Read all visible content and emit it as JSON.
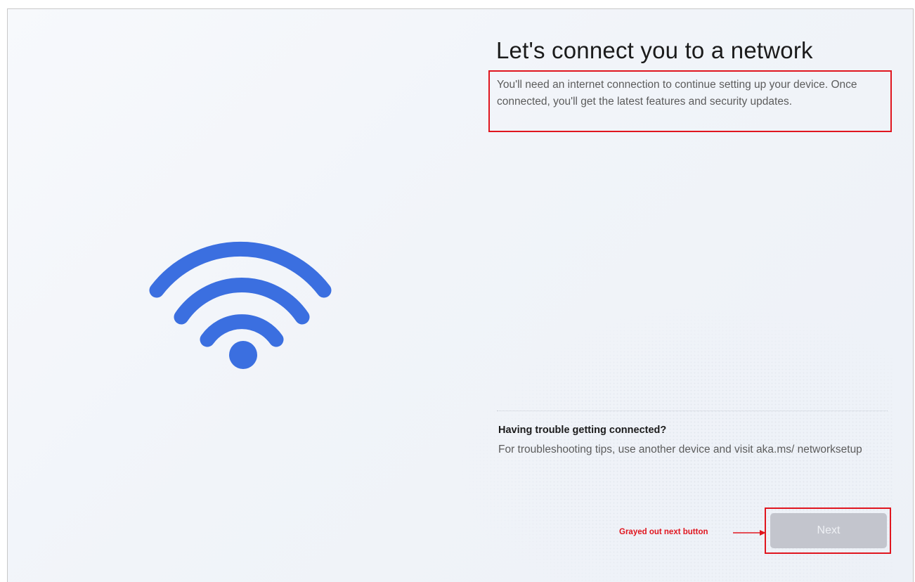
{
  "setup": {
    "title": "Let's connect you to a network",
    "description": "You'll need an internet connection to continue setting up your device. Once connected, you'll get the latest features and security updates.",
    "illustration_icon": "wifi-icon",
    "illustration_color": "#3b6fe0"
  },
  "troubleshooting": {
    "heading": "Having trouble getting connected?",
    "text": "For troubleshooting tips, use another device and visit aka.ms/ networksetup"
  },
  "footer": {
    "next_label": "Next",
    "next_enabled": false
  },
  "annotations": {
    "next_note": "Grayed out next button",
    "highlight_color": "#e0161f",
    "arrow_icon": "arrow-right-icon"
  }
}
